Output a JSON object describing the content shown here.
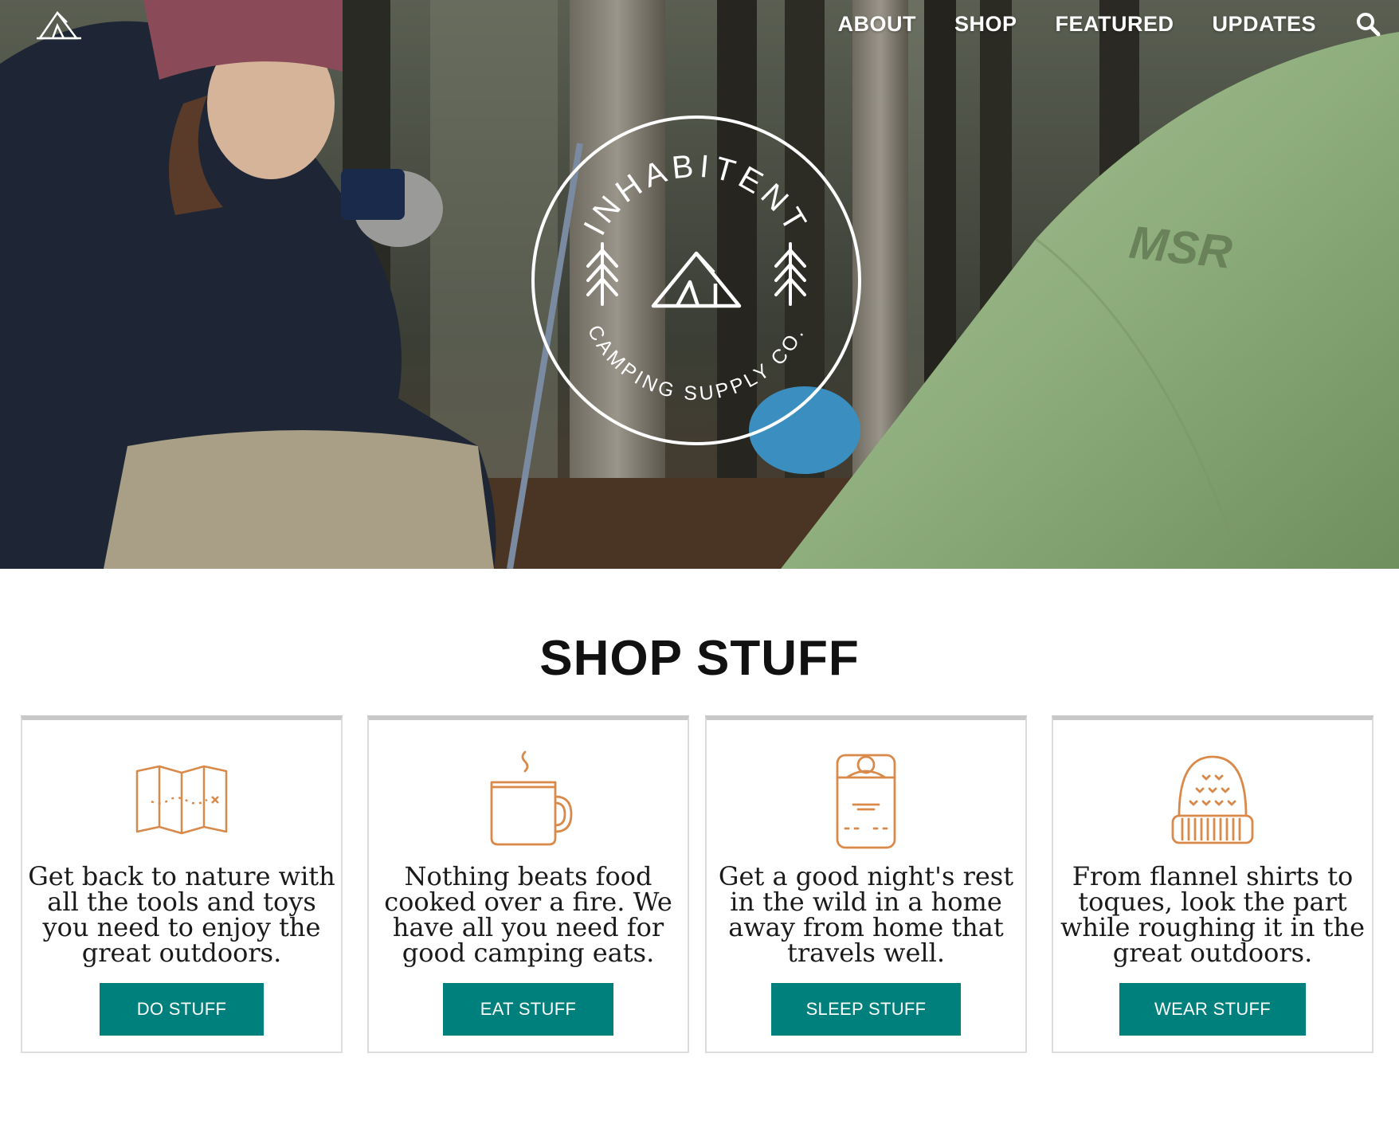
{
  "nav": {
    "items": [
      {
        "label": "ABOUT"
      },
      {
        "label": "SHOP"
      },
      {
        "label": "FEATURED"
      },
      {
        "label": "UPDATES"
      }
    ],
    "search_icon": "search-icon",
    "home_icon": "tent-logo-icon"
  },
  "hero": {
    "badge_top_text": "INHABITENT",
    "badge_bottom_text": "CAMPING SUPPLY CO.",
    "tent_brand_text": "MSR"
  },
  "shop": {
    "title": "SHOP STUFF",
    "cards": [
      {
        "icon": "map-icon",
        "description": "Get back to nature with all the tools and toys you need to enjoy the great outdoors.",
        "button": "DO STUFF"
      },
      {
        "icon": "mug-icon",
        "description": "Nothing beats food cooked over a fire. We have all you need for good camping eats.",
        "button": "EAT STUFF"
      },
      {
        "icon": "sleeping-bag-icon",
        "description": "Get a good night's rest in the wild in a home away from home that travels well.",
        "button": "SLEEP STUFF"
      },
      {
        "icon": "beanie-icon",
        "description": "From flannel shirts to toques, look the part while roughing it in the great outdoors.",
        "button": "WEAR STUFF"
      }
    ]
  },
  "colors": {
    "accent": "#00807c",
    "icon_stroke": "#d98a4a",
    "tent_green": "#8fae7d"
  }
}
